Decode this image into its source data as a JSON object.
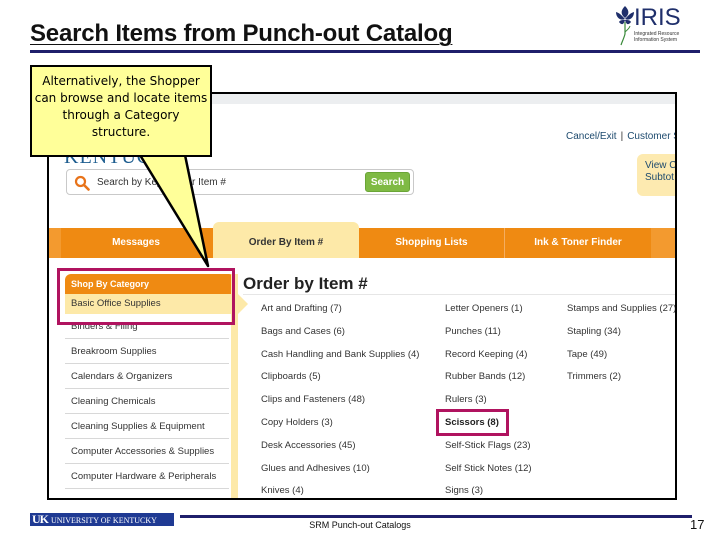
{
  "slide": {
    "title": "Search Items from Punch-out Catalog",
    "logo": {
      "name": "IRIS",
      "subtitle_line1": "Integrated Resource",
      "subtitle_line2": "Information System"
    },
    "callout": "Alternatively, the Shopper can browse and locate items through a Category structure.",
    "footer": {
      "university": "UNIVERSITY OF KENTUCKY",
      "university_mark": "UK",
      "center_text": "SRM Punch-out Catalogs",
      "page_number": "17"
    }
  },
  "app": {
    "brand_fragment": "KENTUCKY",
    "header_links": [
      "Cancel/Exit",
      "Customer Se"
    ],
    "cart": {
      "line1": "View Ca",
      "line2": "Subtot"
    },
    "search": {
      "placeholder": "Search by Keyword or Item #",
      "button_label": "Search"
    },
    "nav_tabs": [
      {
        "label": "Messages",
        "active": false
      },
      {
        "label": "Order By Item #",
        "active": true
      },
      {
        "label": "Shopping Lists",
        "active": false
      },
      {
        "label": "Ink & Toner Finder",
        "active": false
      }
    ],
    "sidebar": {
      "header": "Shop By Category",
      "items": [
        {
          "label": "Basic Office Supplies",
          "selected": true
        },
        {
          "label": "Binders & Filing",
          "selected": false
        },
        {
          "label": "Breakroom Supplies",
          "selected": false
        },
        {
          "label": "Calendars & Organizers",
          "selected": false
        },
        {
          "label": "Cleaning Chemicals",
          "selected": false
        },
        {
          "label": "Cleaning Supplies & Equipment",
          "selected": false
        },
        {
          "label": "Computer Accessories & Supplies",
          "selected": false
        },
        {
          "label": "Computer Hardware & Peripherals",
          "selected": false
        }
      ]
    },
    "main": {
      "title": "Order by Item #",
      "columns": [
        [
          "Art and Drafting (7)",
          "Bags and Cases (6)",
          "Cash Handling and Bank Supplies (4)",
          "Clipboards (5)",
          "Clips and Fasteners (48)",
          "Copy Holders (3)",
          "Desk Accessories (45)",
          "Glues and Adhesives (10)",
          "Knives (4)"
        ],
        [
          "Letter Openers (1)",
          "Punches (11)",
          "Record Keeping (4)",
          "Rubber Bands (12)",
          "Rulers (3)",
          "Scissors (8)",
          "Self-Stick Flags (23)",
          "Self Stick Notes (12)",
          "Signs (3)"
        ],
        [
          "Stamps and Supplies (27)",
          "Stapling (34)",
          "Tape (49)",
          "Trimmers (2)"
        ]
      ],
      "highlighted_item": "Scissors (8)"
    }
  },
  "colors": {
    "accent_orange": "#ef8a12",
    "active_tab": "#fde9a8",
    "highlight_box": "#b0135f",
    "callout_fill": "#ffff99",
    "search_button": "#7fba44",
    "title_rule": "#1f1f6b"
  }
}
